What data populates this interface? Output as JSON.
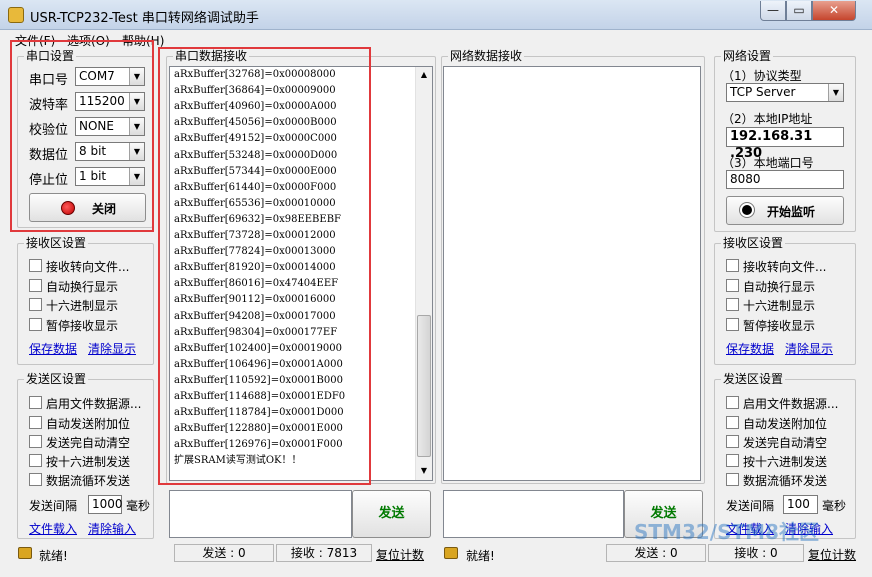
{
  "window": {
    "title": "USR-TCP232-Test 串口转网络调试助手",
    "buttons": [
      "—",
      "▭",
      "✕"
    ]
  },
  "menu": [
    "文件(F)",
    "选项(O)",
    "帮助(H)"
  ],
  "serial_settings": {
    "title": "串口设置",
    "fields": [
      {
        "label": "串口号",
        "value": "COM7"
      },
      {
        "label": "波特率",
        "value": "115200"
      },
      {
        "label": "校验位",
        "value": "NONE"
      },
      {
        "label": "数据位",
        "value": "8 bit"
      },
      {
        "label": "停止位",
        "value": "1 bit"
      }
    ],
    "toggle_button": "关闭"
  },
  "left_rx_settings": {
    "title": "接收区设置",
    "options": [
      "接收转向文件...",
      "自动换行显示",
      "十六进制显示",
      "暂停接收显示"
    ],
    "links": [
      "保存数据",
      "清除显示"
    ]
  },
  "left_tx_settings": {
    "title": "发送区设置",
    "options": [
      "启用文件数据源...",
      "自动发送附加位",
      "发送完自动清空",
      "按十六进制发送",
      "数据流循环发送"
    ],
    "interval_label": "发送间隔",
    "interval_value": "1000",
    "interval_unit": "毫秒",
    "links": [
      "文件载入",
      "清除输入"
    ]
  },
  "serial_rx": {
    "title": "串口数据接收",
    "lines": [
      "aRxBuffer[32768]=0x00008000",
      "aRxBuffer[36864]=0x00009000",
      "aRxBuffer[40960]=0x0000A000",
      "aRxBuffer[45056]=0x0000B000",
      "aRxBuffer[49152]=0x0000C000",
      "aRxBuffer[53248]=0x0000D000",
      "aRxBuffer[57344]=0x0000E000",
      "aRxBuffer[61440]=0x0000F000",
      "aRxBuffer[65536]=0x00010000",
      "aRxBuffer[69632]=0x98EEBEBF",
      "aRxBuffer[73728]=0x00012000",
      "aRxBuffer[77824]=0x00013000",
      "aRxBuffer[81920]=0x00014000",
      "aRxBuffer[86016]=0x47404EEF",
      "aRxBuffer[90112]=0x00016000",
      "aRxBuffer[94208]=0x00017000",
      "aRxBuffer[98304]=0x000177EF",
      "aRxBuffer[102400]=0x00019000",
      "aRxBuffer[106496]=0x0001A000",
      "aRxBuffer[110592]=0x0001B000",
      "aRxBuffer[114688]=0x0001EDF0",
      "aRxBuffer[118784]=0x0001D000",
      "aRxBuffer[122880]=0x0001E000",
      "aRxBuffer[126976]=0x0001F000",
      "扩展SRAM读写测试OK！！"
    ]
  },
  "net_rx": {
    "title": "网络数据接收"
  },
  "send_button": "发送",
  "net_send_button": "发送",
  "net_settings": {
    "title": "网络设置",
    "protocol_label": "（1）协议类型",
    "protocol_value": "TCP Server",
    "ip_label": "（2）本地IP地址",
    "ip_value": "192.168.31 .230",
    "port_label": "（3）本地端口号",
    "port_value": "8080",
    "listen_button": "开始监听"
  },
  "right_rx_settings": {
    "title": "接收区设置",
    "options": [
      "接收转向文件...",
      "自动换行显示",
      "十六进制显示",
      "暂停接收显示"
    ],
    "links": [
      "保存数据",
      "清除显示"
    ]
  },
  "right_tx_settings": {
    "title": "发送区设置",
    "options": [
      "启用文件数据源...",
      "自动发送附加位",
      "发送完自动清空",
      "按十六进制发送",
      "数据流循环发送"
    ],
    "interval_label": "发送间隔",
    "interval_value": "100",
    "interval_unit": "毫秒",
    "links": [
      "文件载入",
      "清除输入"
    ]
  },
  "status_left": {
    "ready": "就绪!",
    "send": "发送 : 0",
    "recv": "接收 : 7813",
    "reset": "复位计数"
  },
  "status_right": {
    "ready": "就绪!",
    "send": "发送 : 0",
    "recv": "接收 : 0",
    "reset": "复位计数"
  },
  "watermark": "STM32/STM8社区"
}
